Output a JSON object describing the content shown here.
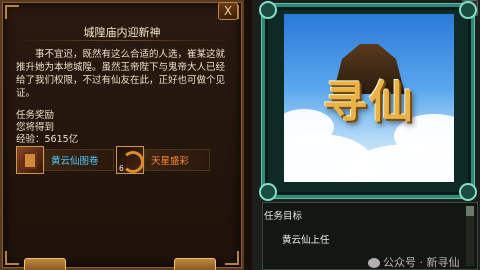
{
  "quest": {
    "title": "城隍庙内迎新神",
    "description": "事不宜迟，既然有这么合适的人选，崔某这就推升她为本地城隍。虽然玉帝陛下与鬼帝大人已经给了我们权限，不过有仙友在此，正好也可做个见证。",
    "reward_header": "任务奖励",
    "reward_sub": "您将得到",
    "exp_label": "经验：",
    "exp_value": "5615亿",
    "items": [
      {
        "name": "黄云仙图卷",
        "icon": "scroll-book-icon",
        "color": "#4fc8ff",
        "count": ""
      },
      {
        "name": "天星盛彩",
        "icon": "dragon-icon",
        "color": "#ff8a30",
        "count": "6"
      }
    ],
    "close_label": "X"
  },
  "target": {
    "label": "任务目标",
    "value": "黄云仙上任"
  },
  "artwork": {
    "logo_text": "寻仙"
  },
  "watermark": {
    "text": "公众号 · 新寻仙"
  }
}
